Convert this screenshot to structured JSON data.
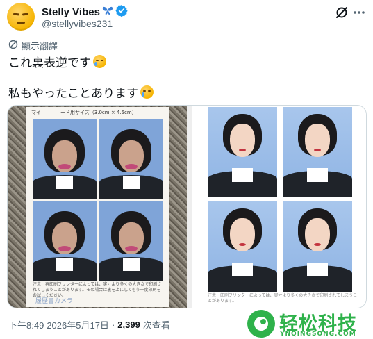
{
  "author": {
    "display_name": "Stelly Vibes",
    "handle": "@stellyvibes231",
    "name_emoji": "butterfly-icon",
    "verified_color": "#1d9bf0"
  },
  "translate_label": "顯示翻譯",
  "tweet": {
    "line1": "これ裏表逆です",
    "line2": "私もやったことあります"
  },
  "media": {
    "left_sheet_header": "マイ　　　　ード用サイズ（3.0cm × 4.5cm）",
    "left_sheet_note": "注意：再印刷フリンターによっては、実寸より多くの大きさで印刷されてしまうことがあります。その場合は裏を上にしてもう一度印刷をお試しください。",
    "left_sheet_brand": "履歴書カメラ",
    "right_sheet_note": "注意：印刷フリンターによっては、実寸より多くの大きさで印刷されてしまうことがあります。"
  },
  "footer": {
    "time": "下午8:49",
    "date": "2026年5月17日",
    "separator": "·",
    "views_count": "2,399",
    "views_label": "次查看"
  },
  "watermark": {
    "title": "轻松科技",
    "subtitle": "YNQINGSONG.COM",
    "color": "#2fb24b"
  }
}
